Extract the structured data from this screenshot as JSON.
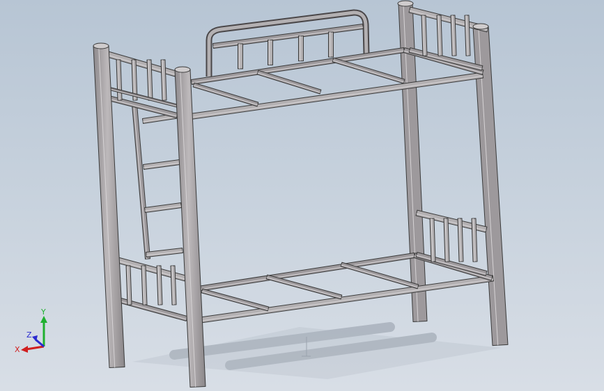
{
  "viewport": {
    "background_top": "#b7c5d4",
    "background_bottom": "#d8dee6"
  },
  "model": {
    "object": "bunk-bed-frame",
    "edge_color": "#3a3a3a",
    "face_light": "#b3b0b2",
    "face_mid": "#9d999c",
    "face_dark": "#7e7a7d",
    "shadow_color": "#7d8794"
  },
  "triad": {
    "x_label": "X",
    "y_label": "Y",
    "z_label": "Z",
    "x_color": "#d01f1f",
    "y_color": "#1fb02f",
    "z_color": "#2a2ad0"
  }
}
